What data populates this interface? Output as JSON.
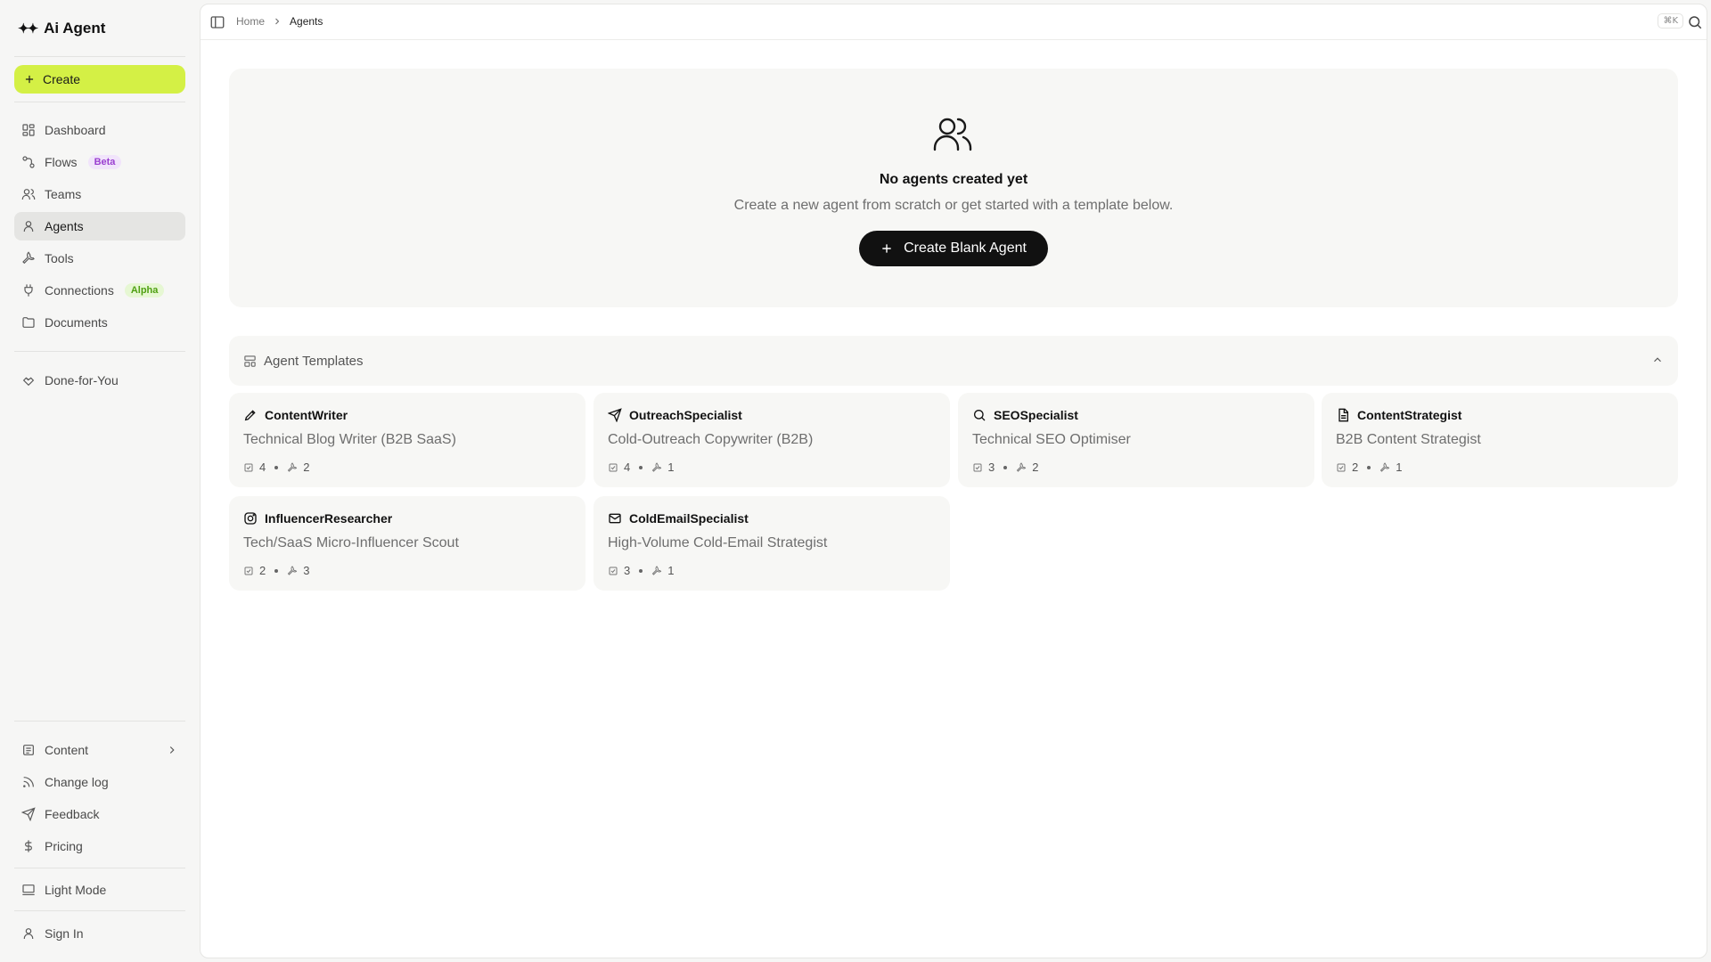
{
  "app": {
    "name": "Ai Agent"
  },
  "sidebar": {
    "create_label": "Create",
    "nav": [
      {
        "label": "Dashboard",
        "icon": "dashboard-icon"
      },
      {
        "label": "Flows",
        "icon": "flows-icon",
        "badge": "Beta"
      },
      {
        "label": "Teams",
        "icon": "teams-icon"
      },
      {
        "label": "Agents",
        "icon": "agent-icon",
        "active": true
      },
      {
        "label": "Tools",
        "icon": "wrench-icon"
      },
      {
        "label": "Connections",
        "icon": "plug-icon",
        "badge": "Alpha"
      },
      {
        "label": "Documents",
        "icon": "folder-icon"
      }
    ],
    "done_for_you": "Done-for-You",
    "bottom": {
      "content": "Content",
      "changelog": "Change log",
      "feedback": "Feedback",
      "pricing": "Pricing",
      "theme": "Light Mode",
      "signin": "Sign In"
    }
  },
  "topbar": {
    "breadcrumb": {
      "home": "Home",
      "current": "Agents"
    },
    "shortcut": "⌘K"
  },
  "empty_state": {
    "title": "No agents created yet",
    "subtitle": "Create a new agent from scratch or get started with a template below.",
    "button": "Create Blank Agent"
  },
  "templates": {
    "header": "Agent Templates",
    "cards": [
      {
        "name": "ContentWriter",
        "desc": "Technical Blog Writer (B2B SaaS)",
        "tasks": "4",
        "tools": "2",
        "icon": "pen-icon"
      },
      {
        "name": "OutreachSpecialist",
        "desc": "Cold-Outreach Copywriter (B2B)",
        "tasks": "4",
        "tools": "1",
        "icon": "send-icon"
      },
      {
        "name": "SEOSpecialist",
        "desc": "Technical SEO Optimiser",
        "tasks": "3",
        "tools": "2",
        "icon": "search-icon"
      },
      {
        "name": "ContentStrategist",
        "desc": "B2B Content Strategist",
        "tasks": "2",
        "tools": "1",
        "icon": "document-icon"
      },
      {
        "name": "InfluencerResearcher",
        "desc": "Tech/SaaS Micro-Influencer Scout",
        "tasks": "2",
        "tools": "3",
        "icon": "instagram-icon"
      },
      {
        "name": "ColdEmailSpecialist",
        "desc": "High-Volume Cold-Email Strategist",
        "tasks": "3",
        "tools": "1",
        "icon": "mail-icon"
      }
    ]
  },
  "colors": {
    "accent": "#d4f045",
    "primary_button": "#111111"
  }
}
